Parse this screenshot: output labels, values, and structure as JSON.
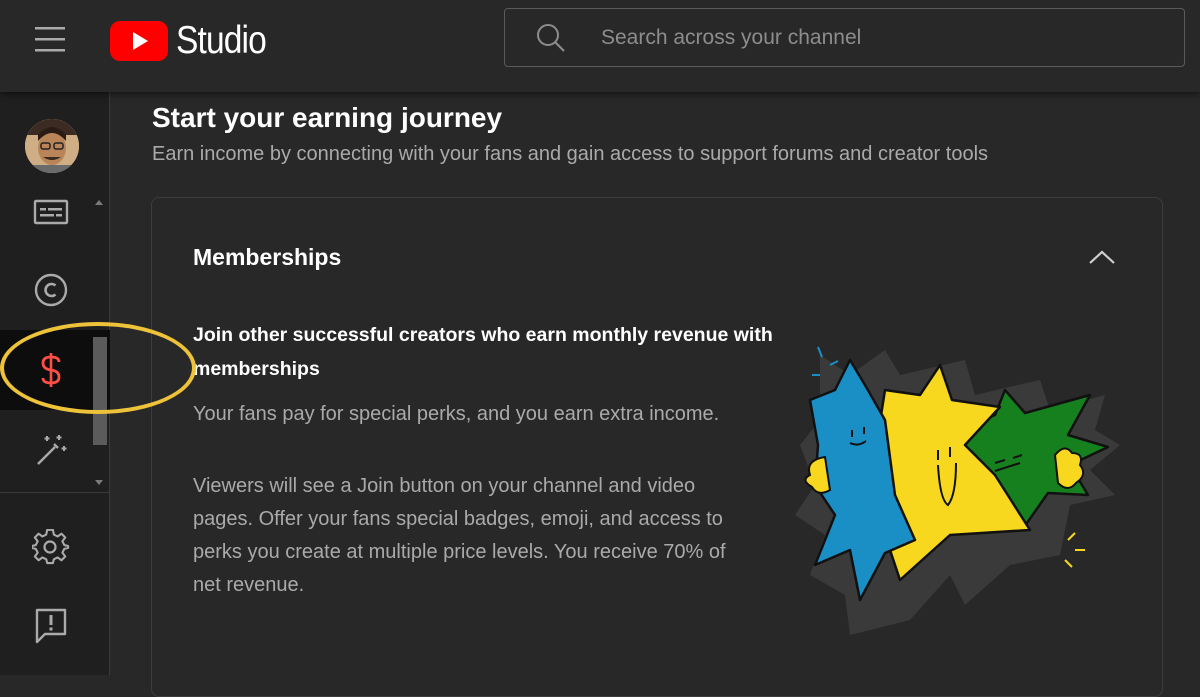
{
  "header": {
    "logo_text": "Studio",
    "search_placeholder": "Search across your channel"
  },
  "sidebar": {
    "items": [
      {
        "name": "subtitles",
        "icon": "subtitles-icon"
      },
      {
        "name": "copyright",
        "icon": "copyright-icon"
      },
      {
        "name": "earn",
        "icon": "dollar-icon",
        "active": true
      },
      {
        "name": "customization",
        "icon": "magic-wand-icon"
      },
      {
        "name": "settings",
        "icon": "gear-icon"
      },
      {
        "name": "feedback",
        "icon": "feedback-icon"
      }
    ]
  },
  "main": {
    "title": "Start your earning journey",
    "subtitle": "Earn income by connecting with your fans and gain access to support forums and creator tools",
    "card": {
      "title": "Memberships",
      "headline": "Join other successful creators who earn monthly revenue with memberships",
      "paragraph1": "Your fans pay for special perks, and you earn extra income.",
      "paragraph2": "Viewers will see a Join button on your channel and video pages. Offer your fans special badges, emoji, and access to perks you create at multiple price levels. You receive 70% of net revenue."
    }
  },
  "colors": {
    "background": "#282828",
    "sidebar": "#1f1f1f",
    "youtube_red": "#ff0000",
    "active_icon": "#ff4e45",
    "highlight_ring": "#eec33a",
    "illus_blue": "#1a8fc6",
    "illus_yellow": "#f7d81f",
    "illus_green": "#16801f"
  }
}
